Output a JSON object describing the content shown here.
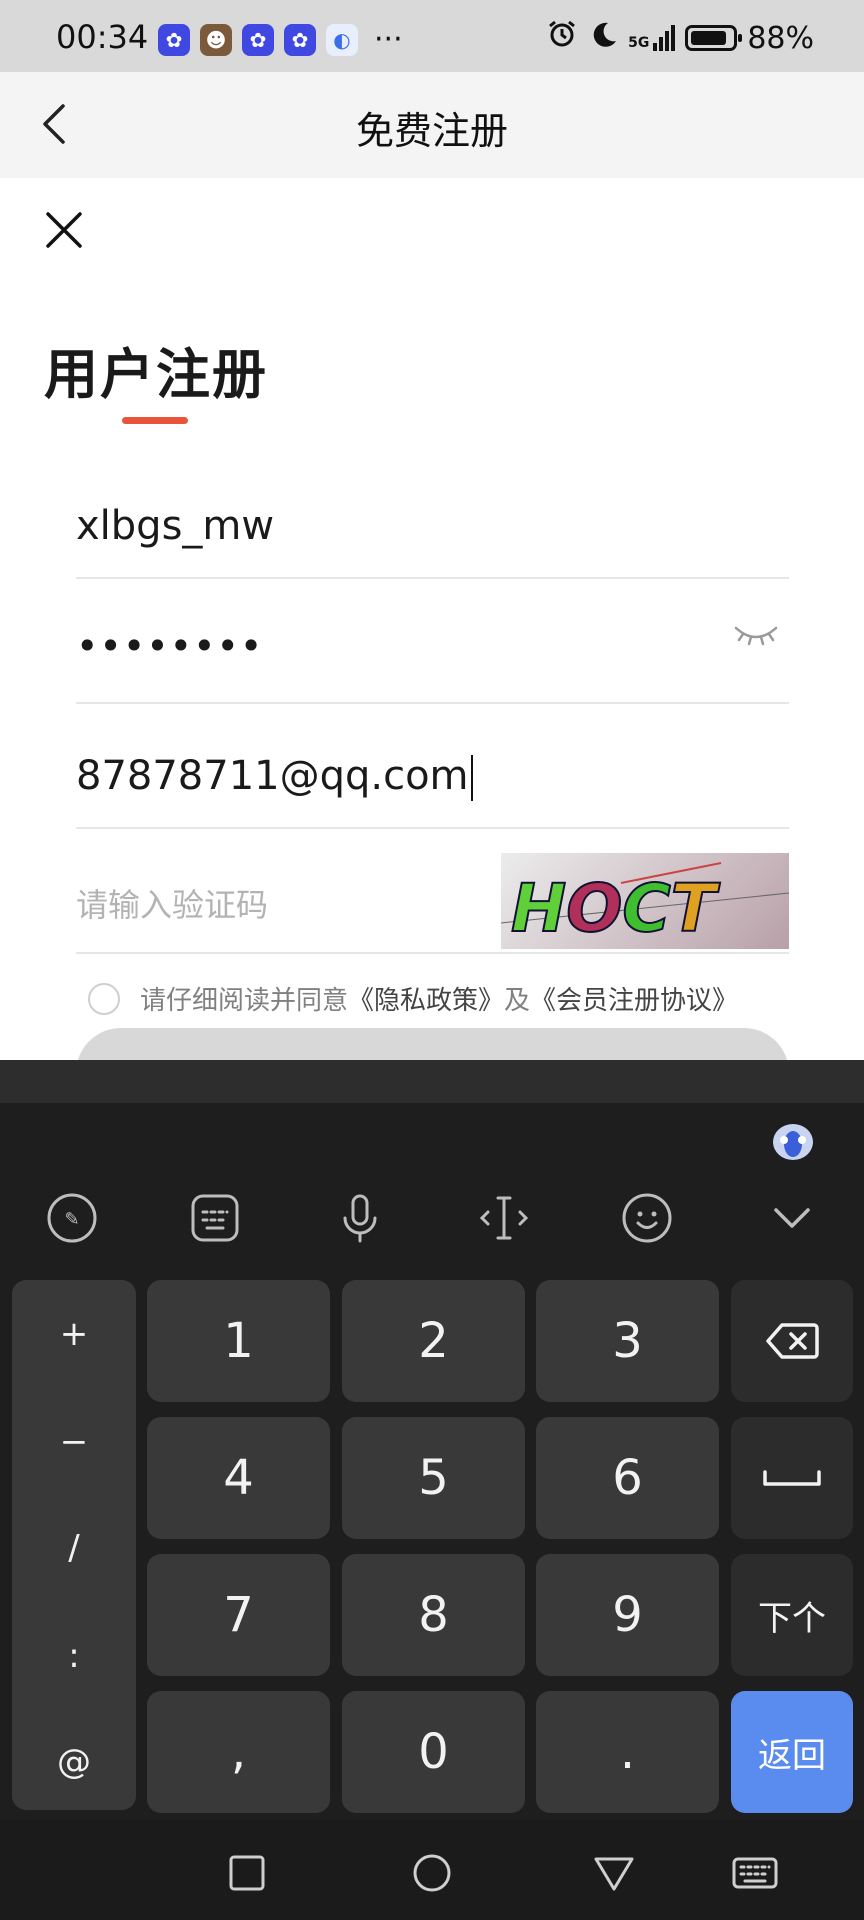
{
  "status_bar": {
    "time": "00:34",
    "more": "···",
    "network": "5G",
    "battery_percent": "88%",
    "battery_level": 0.88
  },
  "header": {
    "title": "免费注册"
  },
  "form": {
    "heading": "用户注册",
    "username_value": "xlbgs_mw",
    "password_value": "••••••••",
    "email_value": "87878711@qq.com",
    "captcha_placeholder": "请输入验证码",
    "captcha_text": "HOCT",
    "agree_prefix": "请仔细阅读并同意",
    "privacy_link": "《隐私政策》",
    "agree_join": "及",
    "member_link": "《会员注册协议》"
  },
  "keyboard": {
    "symbols": [
      "+",
      "−",
      "/",
      ":",
      "@"
    ],
    "digits": [
      "1",
      "2",
      "3",
      "4",
      "5",
      "6",
      "7",
      "8",
      "9"
    ],
    "comma": ",",
    "zero": "0",
    "dot": ".",
    "next_label": "下个",
    "return_label": "返回"
  },
  "colors": {
    "accent": "#e8553a",
    "keyboard_blue": "#5a8cf0"
  }
}
